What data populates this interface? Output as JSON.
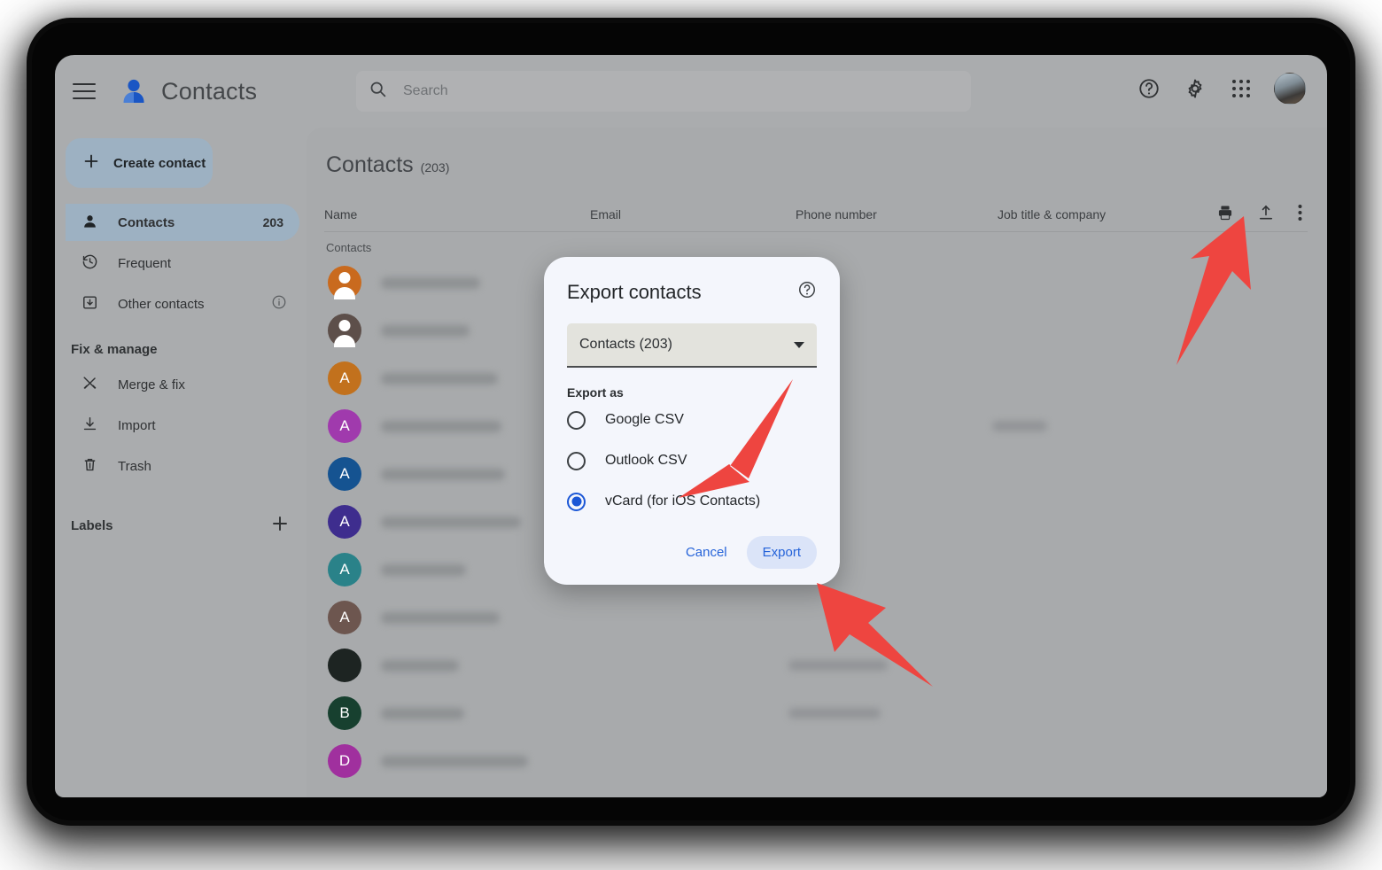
{
  "app": {
    "title": "Contacts",
    "brand_icon": "contacts-person-icon",
    "menu_icon": "hamburger-menu-icon"
  },
  "search": {
    "placeholder": "Search",
    "icon": "search-icon"
  },
  "header_actions": [
    {
      "name": "help-icon",
      "label": "Help"
    },
    {
      "name": "settings-gear-icon",
      "label": "Settings"
    },
    {
      "name": "google-apps-grid-icon",
      "label": "Google apps"
    },
    {
      "name": "account-avatar",
      "label": "Account"
    }
  ],
  "sidebar": {
    "create_button": {
      "label": "Create contact",
      "icon": "plus-icon"
    },
    "items": [
      {
        "label": "Contacts",
        "icon": "person-icon",
        "count": "203",
        "active": true
      },
      {
        "label": "Frequent",
        "icon": "history-clock-icon",
        "count": "",
        "active": false
      },
      {
        "label": "Other contacts",
        "icon": "archive-down-icon",
        "count": "",
        "active": false,
        "trailing_icon": "info-icon"
      }
    ],
    "section_label": "Fix & manage",
    "manage_items": [
      {
        "label": "Merge & fix",
        "icon": "merge-tools-icon"
      },
      {
        "label": "Import",
        "icon": "import-download-icon"
      },
      {
        "label": "Trash",
        "icon": "trash-icon"
      }
    ],
    "labels_header": {
      "label": "Labels",
      "add_icon": "plus-icon"
    }
  },
  "main": {
    "title": "Contacts",
    "count": "(203)",
    "columns": [
      "Name",
      "Email",
      "Phone number",
      "Job title & company"
    ],
    "toolbar": [
      {
        "name": "print-icon",
        "label": "Print"
      },
      {
        "name": "export-upload-icon",
        "label": "Export"
      },
      {
        "name": "more-options-icon",
        "label": "More"
      }
    ],
    "group_label": "Contacts",
    "rows": [
      {
        "avatar_letter": "",
        "avatar_color": "#c96a1e",
        "avatar_type": "silhouette",
        "name_w": 112,
        "email_w": 0,
        "phone_w": 0,
        "job_w": 0
      },
      {
        "avatar_letter": "",
        "avatar_color": "#5d4f4a",
        "avatar_type": "silhouette",
        "name_w": 100,
        "email_w": 82,
        "phone_w": 0,
        "job_w": 0
      },
      {
        "avatar_letter": "A",
        "avatar_color": "#c2711d",
        "avatar_type": "letter",
        "name_w": 132,
        "email_w": 0,
        "phone_w": 0,
        "job_w": 0
      },
      {
        "avatar_letter": "A",
        "avatar_color": "#a03aad",
        "avatar_type": "letter",
        "name_w": 136,
        "email_w": 0,
        "phone_w": 0,
        "job_w": 62
      },
      {
        "avatar_letter": "A",
        "avatar_color": "#155391",
        "avatar_type": "letter",
        "name_w": 140,
        "email_w": 88,
        "phone_w": 0,
        "job_w": 0
      },
      {
        "avatar_letter": "A",
        "avatar_color": "#3e2d8e",
        "avatar_type": "letter",
        "name_w": 158,
        "email_w": 0,
        "phone_w": 0,
        "job_w": 0
      },
      {
        "avatar_letter": "A",
        "avatar_color": "#2a8289",
        "avatar_type": "letter",
        "name_w": 96,
        "email_w": 0,
        "phone_w": 0,
        "job_w": 0
      },
      {
        "avatar_letter": "A",
        "avatar_color": "#6d564f",
        "avatar_type": "letter",
        "name_w": 134,
        "email_w": 0,
        "phone_w": 0,
        "job_w": 0
      },
      {
        "avatar_letter": "",
        "avatar_color": "#1d2422",
        "avatar_type": "plain",
        "name_w": 88,
        "email_w": 0,
        "phone_w": 112,
        "job_w": 0
      },
      {
        "avatar_letter": "B",
        "avatar_color": "#17402f",
        "avatar_type": "letter",
        "name_w": 94,
        "email_w": 0,
        "phone_w": 104,
        "job_w": 0
      },
      {
        "avatar_letter": "D",
        "avatar_color": "#a0309e",
        "avatar_type": "letter",
        "name_w": 166,
        "email_w": 0,
        "phone_w": 0,
        "job_w": 0
      }
    ]
  },
  "dialog": {
    "title": "Export contacts",
    "help_icon": "help-circle-icon",
    "select_value": "Contacts (203)",
    "select_caret": "chevron-down-icon",
    "export_as_label": "Export as",
    "options": [
      {
        "label": "Google CSV",
        "checked": false
      },
      {
        "label": "Outlook CSV",
        "checked": false
      },
      {
        "label": "vCard (for iOS Contacts)",
        "checked": true
      }
    ],
    "cancel_label": "Cancel",
    "export_label": "Export"
  },
  "annotations": {
    "arrow_color": "#ee4540",
    "arrows": [
      {
        "name": "arrow-to-export-toolbar-icon"
      },
      {
        "name": "arrow-to-vcard-option"
      },
      {
        "name": "arrow-to-export-button"
      }
    ]
  },
  "colors": {
    "accent_blue": "#2563d9",
    "sidebar_active": "#9db1c2",
    "window_bg": "#a8aaac",
    "dialog_bg": "#f4f6fc",
    "arrow_red": "#ee4540"
  }
}
